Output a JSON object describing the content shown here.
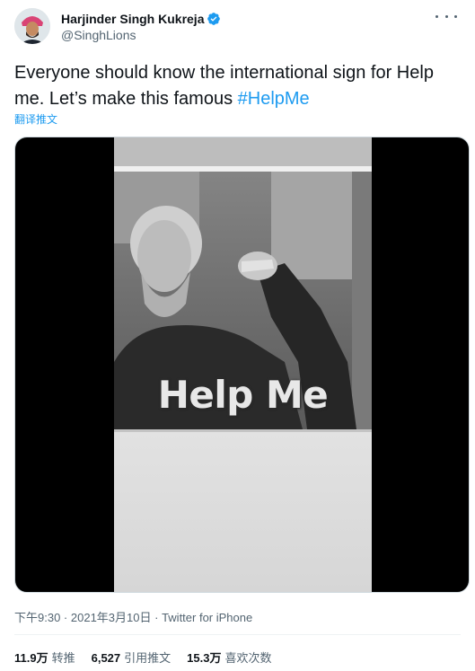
{
  "author": {
    "name": "Harjinder Singh Kukreja",
    "handle": "@SinghLions",
    "verified": true
  },
  "tweet": {
    "text": "Everyone should know the international sign for Help me. Let’s make this famous ",
    "hashtag": "#HelpMe",
    "translate_label": "翻译推文"
  },
  "media": {
    "caption": "Help Me"
  },
  "meta": {
    "time": "下午9:30",
    "date": "2021年3月10日",
    "source": "Twitter for iPhone"
  },
  "stats": {
    "retweets_value": "11.9万",
    "retweets_label": "转推",
    "quotes_value": "6,527",
    "quotes_label": "引用推文",
    "likes_value": "15.3万",
    "likes_label": "喜欢次数"
  },
  "colors": {
    "accent": "#1d9bf0",
    "text": "#0f1419",
    "secondary": "#536471"
  }
}
